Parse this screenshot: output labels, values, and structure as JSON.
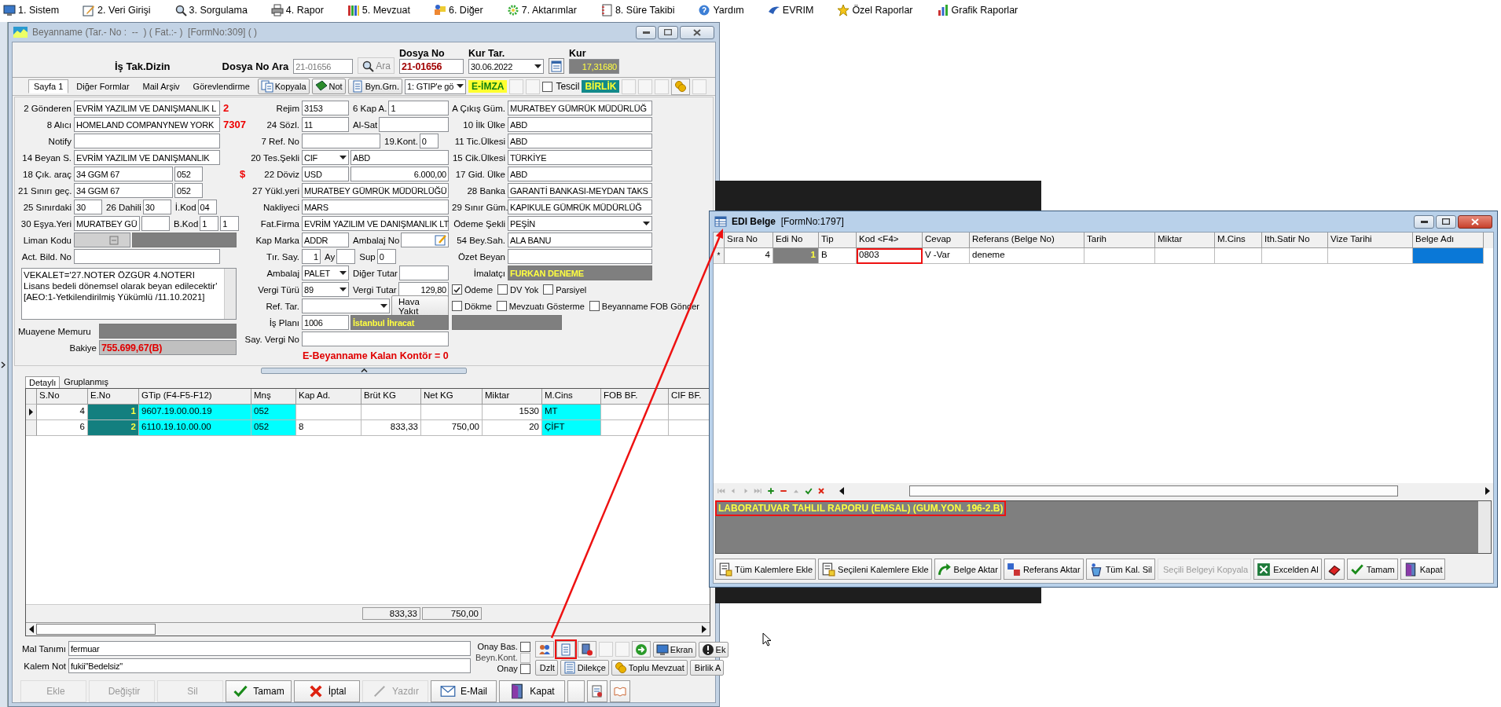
{
  "menu": [
    {
      "label": "1. Sistem"
    },
    {
      "label": "2. Veri Girişi"
    },
    {
      "label": "3. Sorgulama"
    },
    {
      "label": "4. Rapor"
    },
    {
      "label": "5. Mevzuat"
    },
    {
      "label": "6. Diğer"
    },
    {
      "label": "7. Aktarımlar"
    },
    {
      "label": "8. Süre Takibi"
    },
    {
      "label": "Yardım"
    },
    {
      "label": "EVRIM"
    },
    {
      "label": "Özel Raporlar"
    },
    {
      "label": "Grafik Raporlar"
    }
  ],
  "main_window": {
    "title": "Beyanname (Tar.- No :  --  ) ( Fat.:- )  [FormNo:309] ( )",
    "header": {
      "dizin": "İş Tak.Dizin",
      "search_label": "Dosya No Ara",
      "search_value": "21-01656",
      "search_button": "Ara",
      "dosya_label": "Dosya No",
      "dosya_value": "21-01656",
      "kur_tar_label": "Kur Tar.",
      "kur_tar_value": "30.06.2022",
      "kur_label": "Kur",
      "kur_value": "17,31680"
    },
    "tabs": [
      {
        "label": "Sayfa 1",
        "selected": true
      },
      {
        "label": "Diğer Formlar",
        "selected": false
      },
      {
        "label": "Mail Arşiv",
        "selected": false
      },
      {
        "label": "Görevlendirme",
        "selected": false
      }
    ],
    "toolbar": [
      {
        "kind": "button",
        "label": "Kopyala"
      },
      {
        "kind": "button",
        "label": "Not"
      },
      {
        "kind": "button",
        "label": "Byn.Grn."
      },
      {
        "kind": "select",
        "label": "1: GTIP'e gö"
      },
      {
        "kind": "badge",
        "label": "E-İMZA"
      },
      {
        "kind": "blank"
      },
      {
        "kind": "blank"
      },
      {
        "kind": "check",
        "label": "Tescil",
        "checked": false
      },
      {
        "kind": "tag",
        "label": "BİRLİK"
      },
      {
        "kind": "blank"
      },
      {
        "kind": "blank"
      },
      {
        "kind": "blank"
      },
      {
        "kind": "icon"
      },
      {
        "kind": "blank"
      }
    ],
    "form": {
      "columns": [
        {
          "rows": [
            {
              "label": "2 Gönderen",
              "items": [
                {
                  "kind": "field",
                  "value": "EVRİM YAZILIM VE DANIŞMANLIK L"
                },
                {
                  "kind": "mark",
                  "text": "2"
                }
              ]
            },
            {
              "label": "8 Alıcı",
              "items": [
                {
                  "kind": "field",
                  "value": "HOMELAND COMPANYNEW YORK"
                },
                {
                  "kind": "mark",
                  "text": "7307"
                }
              ]
            },
            {
              "label": "Notify",
              "items": [
                {
                  "kind": "field"
                }
              ]
            },
            {
              "label": "14 Beyan S.",
              "items": [
                {
                  "kind": "field",
                  "value": "EVRİM YAZILIM VE DANIŞMANLIK"
                }
              ]
            },
            {
              "label": "18 Çık. araç",
              "items": [
                {
                  "kind": "field-l",
                  "value": "34 GGM 67"
                },
                {
                  "kind": "field-s",
                  "value": "052"
                }
              ]
            },
            {
              "label": "21 Sınırı geç.",
              "items": [
                {
                  "kind": "field-l",
                  "value": "34 GGM 67"
                },
                {
                  "kind": "field-s",
                  "value": "052"
                }
              ]
            },
            {
              "label": "25 Sınırdaki",
              "items": [
                {
                  "kind": "field-s",
                  "value": "30"
                },
                {
                  "kind": "tag",
                  "text": "26 Dahili"
                },
                {
                  "kind": "field-s",
                  "value": "30"
                },
                {
                  "kind": "tag",
                  "text": "İ.Kod"
                },
                {
                  "kind": "field-xs",
                  "value": "04"
                }
              ]
            },
            {
              "label": "30 Eşya.Yeri",
              "items": [
                {
                  "kind": "field-m",
                  "value": "MURATBEY GÜ"
                },
                {
                  "kind": "field-s"
                },
                {
                  "kind": "tag",
                  "text": "B.Kod"
                },
                {
                  "kind": "field-xs",
                  "value": "1"
                },
                {
                  "kind": "field-xs",
                  "value": "1"
                }
              ]
            },
            {
              "label": "Liman Kodu",
              "items": [
                {
                  "kind": "lookup"
                },
                {
                  "kind": "grey"
                }
              ]
            },
            {
              "label": "Act. Bild. No",
              "items": [
                {
                  "kind": "field"
                }
              ]
            },
            {
              "items": [
                {
                  "kind": "memo",
                  "value": "VEKALET='27.NOTER ÖZGÜR 4.NOTERI Lisans bedeli dönemsel olarak beyan edilecektir'  [AEO:1-Yetkilendirilmiş Yükümlü /11.10.2021]"
                }
              ]
            },
            {
              "label": "Muayene Memuru",
              "items": [
                {
                  "kind": "grey"
                }
              ]
            },
            {
              "label": "Bakiye",
              "items": [
                {
                  "kind": "balance",
                  "value": "755.699,67(B)"
                }
              ]
            }
          ]
        },
        {
          "rows": [
            {
              "label": "Rejim",
              "items": [
                {
                  "kind": "field-m",
                  "value": "3153"
                },
                {
                  "kind": "tag",
                  "text": "6 Kap A."
                },
                {
                  "kind": "field",
                  "value": "1"
                }
              ]
            },
            {
              "label": "24 Sözl.",
              "items": [
                {
                  "kind": "field-m",
                  "value": "11"
                },
                {
                  "kind": "tag",
                  "text": "Al-Sat"
                },
                {
                  "kind": "field"
                }
              ]
            },
            {
              "label": "7 Ref. No",
              "items": [
                {
                  "kind": "field-l"
                },
                {
                  "kind": "tag",
                  "text": "19.Kont."
                },
                {
                  "kind": "field-xs",
                  "value": "0"
                }
              ]
            },
            {
              "label": "20 Tes.Şekli",
              "items": [
                {
                  "kind": "select-s",
                  "value": "CIF"
                },
                {
                  "kind": "field",
                  "value": "ABD"
                }
              ]
            },
            {
              "prefix": "$",
              "label": "22 Döviz",
              "items": [
                {
                  "kind": "field-m",
                  "value": "USD"
                },
                {
                  "kind": "num",
                  "value": "6.000,00"
                }
              ]
            },
            {
              "label": "27 Yükl.yeri",
              "items": [
                {
                  "kind": "field",
                  "value": "MURATBEY GÜMRÜK MÜDÜRLÜĞÜ"
                }
              ]
            },
            {
              "label": "Nakliyeci",
              "items": [
                {
                  "kind": "field",
                  "value": "MARS"
                }
              ]
            },
            {
              "label": "Fat.Firma",
              "items": [
                {
                  "kind": "field",
                  "value": "EVRİM YAZILIM VE DANIŞMANLIK LT"
                }
              ]
            },
            {
              "label": "Kap Marka",
              "items": [
                {
                  "kind": "field-m",
                  "value": "ADDR"
                },
                {
                  "kind": "tag",
                  "text": "Ambalaj No"
                },
                {
                  "kind": "pick"
                }
              ]
            },
            {
              "label": "Tır. Say.",
              "items": [
                {
                  "kind": "num-xs",
                  "value": "1"
                },
                {
                  "kind": "tag",
                  "text": "Ay"
                },
                {
                  "kind": "field-xs"
                },
                {
                  "kind": "tag",
                  "text": "Sup"
                },
                {
                  "kind": "field-xs",
                  "value": "0"
                }
              ]
            },
            {
              "label": "Ambalaj",
              "items": [
                {
                  "kind": "select-s",
                  "value": "PALET"
                },
                {
                  "kind": "tag",
                  "text": "Diğer Tutar"
                },
                {
                  "kind": "field"
                }
              ]
            },
            {
              "label": "Vergi Türü",
              "items": [
                {
                  "kind": "select-s",
                  "value": "89"
                },
                {
                  "kind": "tag",
                  "text": "Vergi Tutar"
                },
                {
                  "kind": "num",
                  "value": "129,80"
                }
              ]
            },
            {
              "label": "Ref. Tar.",
              "items": [
                {
                  "kind": "select-l"
                },
                {
                  "kind": "button",
                  "text": "Hava Yakıt"
                }
              ]
            },
            {
              "label": "İş Planı",
              "items": [
                {
                  "kind": "field-m",
                  "value": "1006"
                },
                {
                  "kind": "grey",
                  "value": "İstanbul İhracat"
                }
              ]
            },
            {
              "label": "Say. Vergi No",
              "items": [
                {
                  "kind": "field"
                }
              ]
            },
            {
              "items": [
                {
                  "kind": "notice",
                  "text": "E-Beyanname Kalan Kontör = 0"
                }
              ]
            }
          ]
        },
        {
          "rows": [
            {
              "label": "A Çıkış Güm.",
              "items": [
                {
                  "kind": "field",
                  "value": "MURATBEY GÜMRÜK MÜDÜRLÜĞ"
                }
              ]
            },
            {
              "label": "10 İlk Ülke",
              "items": [
                {
                  "kind": "field",
                  "value": "ABD"
                }
              ]
            },
            {
              "label": "11 Tic.Ülkesi",
              "items": [
                {
                  "kind": "field",
                  "value": "ABD"
                }
              ]
            },
            {
              "label": "15 Cik.Ülkesi",
              "items": [
                {
                  "kind": "field",
                  "value": "TÜRKİYE"
                }
              ]
            },
            {
              "label": "17 Gid. Ülke",
              "items": [
                {
                  "kind": "field",
                  "value": "ABD"
                }
              ]
            },
            {
              "label": "28 Banka",
              "items": [
                {
                  "kind": "field",
                  "value": "GARANTİ BANKASI-MEYDAN TAKS"
                }
              ]
            },
            {
              "label": "29 Sınır Güm.",
              "items": [
                {
                  "kind": "field",
                  "value": "KAPIKULE GÜMRÜK MÜDÜRLÜĞ"
                }
              ]
            },
            {
              "label": "Ödeme Şekli",
              "items": [
                {
                  "kind": "select",
                  "value": "PEŞİN"
                }
              ]
            },
            {
              "label": "54 Bey.Sah.",
              "items": [
                {
                  "kind": "field",
                  "value": "ALA BANU"
                }
              ]
            },
            {
              "label": "Özet Beyan",
              "items": [
                {
                  "kind": "field"
                }
              ]
            },
            {
              "label": "İmalatçı",
              "items": [
                {
                  "kind": "grey",
                  "value": "FURKAN DENEME"
                }
              ]
            },
            {
              "items": [
                {
                  "kind": "check",
                  "text": "Ödeme",
                  "checked": true
                },
                {
                  "kind": "check",
                  "text": "DV Yok",
                  "checked": false
                },
                {
                  "kind": "check",
                  "text": "Parsiyel",
                  "checked": false
                }
              ]
            },
            {
              "items": [
                {
                  "kind": "check",
                  "text": "Dökme",
                  "checked": false
                },
                {
                  "kind": "check",
                  "text": "Mevzuatı Gösterme",
                  "checked": false
                },
                {
                  "kind": "check",
                  "text": "Beyanname FOB Gönder",
                  "checked": false
                }
              ]
            },
            {
              "items": [
                {
                  "kind": "grey-m"
                }
              ]
            }
          ]
        }
      ]
    },
    "detail": {
      "tabs": [
        {
          "label": "Detaylı",
          "selected": true
        },
        {
          "label": "Gruplanmış",
          "selected": false
        }
      ],
      "columns": [
        {
          "label": "S.No",
          "kind": "num"
        },
        {
          "label": "E.No",
          "kind": "key"
        },
        {
          "label": "GTip (F4-F5-F12)",
          "kind": "code"
        },
        {
          "label": "Mnş",
          "kind": "code"
        },
        {
          "label": "Kap Ad.",
          "kind": "text"
        },
        {
          "label": "Brüt KG",
          "kind": "num"
        },
        {
          "label": "Net KG",
          "kind": "num"
        },
        {
          "label": "Miktar",
          "kind": "num"
        },
        {
          "label": "M.Cins",
          "kind": "code"
        },
        {
          "label": "FOB BF.",
          "kind": "num"
        },
        {
          "label": "CIF BF.",
          "kind": "num"
        }
      ],
      "rows": [
        {
          "selected": true,
          "cells": [
            "4",
            "1",
            "9607.19.00.00.19",
            "052",
            null,
            null,
            null,
            "1530",
            "MT",
            null,
            null
          ]
        },
        {
          "selected": false,
          "cells": [
            "6",
            "2",
            "6110.19.10.00.00",
            "052",
            "8",
            "833,33",
            "750,00",
            "20",
            "ÇİFT",
            null,
            null
          ]
        }
      ],
      "totals": [
        {
          "text": "833,33"
        },
        {
          "text": "750,00"
        }
      ]
    },
    "item_panel": {
      "fields": [
        {
          "label": "Mal Tanımı",
          "value": "fermuar"
        },
        {
          "label": "Kalem Not",
          "value": "fukii\"Bedelsiz\""
        }
      ],
      "checks": [
        {
          "label": "Onay Bas.",
          "checked": false,
          "disabled": false
        },
        {
          "label": "Beyn.Kont.",
          "checked": false,
          "disabled": true
        },
        {
          "label": "Onay",
          "checked": false,
          "disabled": false
        }
      ],
      "tools_top": [
        {
          "kind": "icon",
          "highlighted": false
        },
        {
          "kind": "icon",
          "highlighted": true
        },
        {
          "kind": "icon",
          "highlighted": false
        },
        {
          "kind": "blank",
          "highlighted": false
        },
        {
          "kind": "blank",
          "highlighted": false
        },
        {
          "kind": "icon",
          "highlighted": false
        },
        {
          "kind": "button",
          "label": "Ekran",
          "highlighted": false
        },
        {
          "kind": "button",
          "label": "Ek",
          "highlighted": false
        }
      ],
      "tools_bottom": [
        {
          "label": "Dzlt"
        },
        {
          "label": "Dilekçe"
        },
        {
          "label": "Toplu Mevzuat"
        },
        {
          "label": "Birlik A"
        }
      ]
    },
    "buttons": [
      {
        "kind": "button",
        "label": "Ekle",
        "disabled": true
      },
      {
        "kind": "button",
        "label": "Değiştir",
        "disabled": true
      },
      {
        "kind": "button",
        "label": "Sil",
        "disabled": true
      },
      {
        "kind": "button",
        "label": "Tamam",
        "disabled": false
      },
      {
        "kind": "button",
        "label": "İptal",
        "disabled": false
      },
      {
        "kind": "button",
        "label": "Yazdır",
        "disabled": true
      },
      {
        "kind": "button",
        "label": "E-Mail",
        "disabled": false
      },
      {
        "kind": "button",
        "label": "Kapat",
        "disabled": false
      },
      {
        "kind": "blank",
        "disabled": false
      },
      {
        "kind": "icon",
        "disabled": false
      },
      {
        "kind": "icon",
        "disabled": false
      }
    ]
  },
  "edi_window": {
    "title": "**EDI Belge**  [FormNo:1797]",
    "columns": [
      {
        "label": "Sıra No",
        "kind": "num"
      },
      {
        "label": "Edi No",
        "kind": "key"
      },
      {
        "label": "Tip",
        "kind": "text"
      },
      {
        "label": "Kod <F4>",
        "kind": "text"
      },
      {
        "label": "Cevap",
        "kind": "text"
      },
      {
        "label": "Referans (Belge No)",
        "kind": "text"
      },
      {
        "label": "Tarih",
        "kind": "text"
      },
      {
        "label": "Miktar",
        "kind": "text"
      },
      {
        "label": "M.Cins",
        "kind": "text"
      },
      {
        "label": "Ith.Satir No",
        "kind": "text"
      },
      {
        "label": "Vize Tarihi",
        "kind": "text"
      },
      {
        "label": "Belge Adı",
        "kind": "text"
      }
    ],
    "rows": [
      {
        "marker": "*",
        "cells": [
          {
            "text": "4",
            "selected": false,
            "highlighted": false
          },
          {
            "text": "1",
            "selected": false,
            "highlighted": false
          },
          {
            "text": "B",
            "selected": false,
            "highlighted": false
          },
          {
            "text": "0803",
            "selected": false,
            "highlighted": true
          },
          {
            "text": "V -Var",
            "selected": false,
            "highlighted": false
          },
          {
            "text": "deneme",
            "selected": false,
            "highlighted": false
          },
          {
            "selected": false,
            "highlighted": false
          },
          {
            "selected": false,
            "highlighted": false
          },
          {
            "selected": false,
            "highlighted": false
          },
          {
            "selected": false,
            "highlighted": false
          },
          {
            "selected": false,
            "highlighted": false
          },
          {
            "selected": true,
            "highlighted": false
          }
        ]
      }
    ],
    "navigator": [
      {
        "disabled": true
      },
      {
        "disabled": true
      },
      {
        "disabled": true
      },
      {
        "disabled": true
      },
      {
        "disabled": false
      },
      {
        "disabled": false
      },
      {
        "disabled": true
      },
      {
        "disabled": false
      },
      {
        "disabled": false
      }
    ],
    "memo": {
      "text": "LABORATUVAR TAHLIL RAPORU (EMSAL) (GUM.YON. 196-2.B)",
      "highlighted": true
    },
    "buttons": [
      {
        "label": "Tüm Kalemlere Ekle",
        "disabled": false
      },
      {
        "label": "Seçileni Kalemlere Ekle",
        "disabled": false
      },
      {
        "label": "Belge Aktar",
        "disabled": false
      },
      {
        "label": "Referans Aktar",
        "disabled": false
      },
      {
        "label": "Tüm Kal. Sil",
        "disabled": false
      },
      {
        "label": "Seçili Belgeyi Kopyala",
        "disabled": true
      },
      {
        "label": "Excelden Al",
        "disabled": false
      },
      {
        "disabled": false
      },
      {
        "label": "Tamam",
        "disabled": false
      },
      {
        "label": "Kapat",
        "disabled": false
      }
    ]
  }
}
